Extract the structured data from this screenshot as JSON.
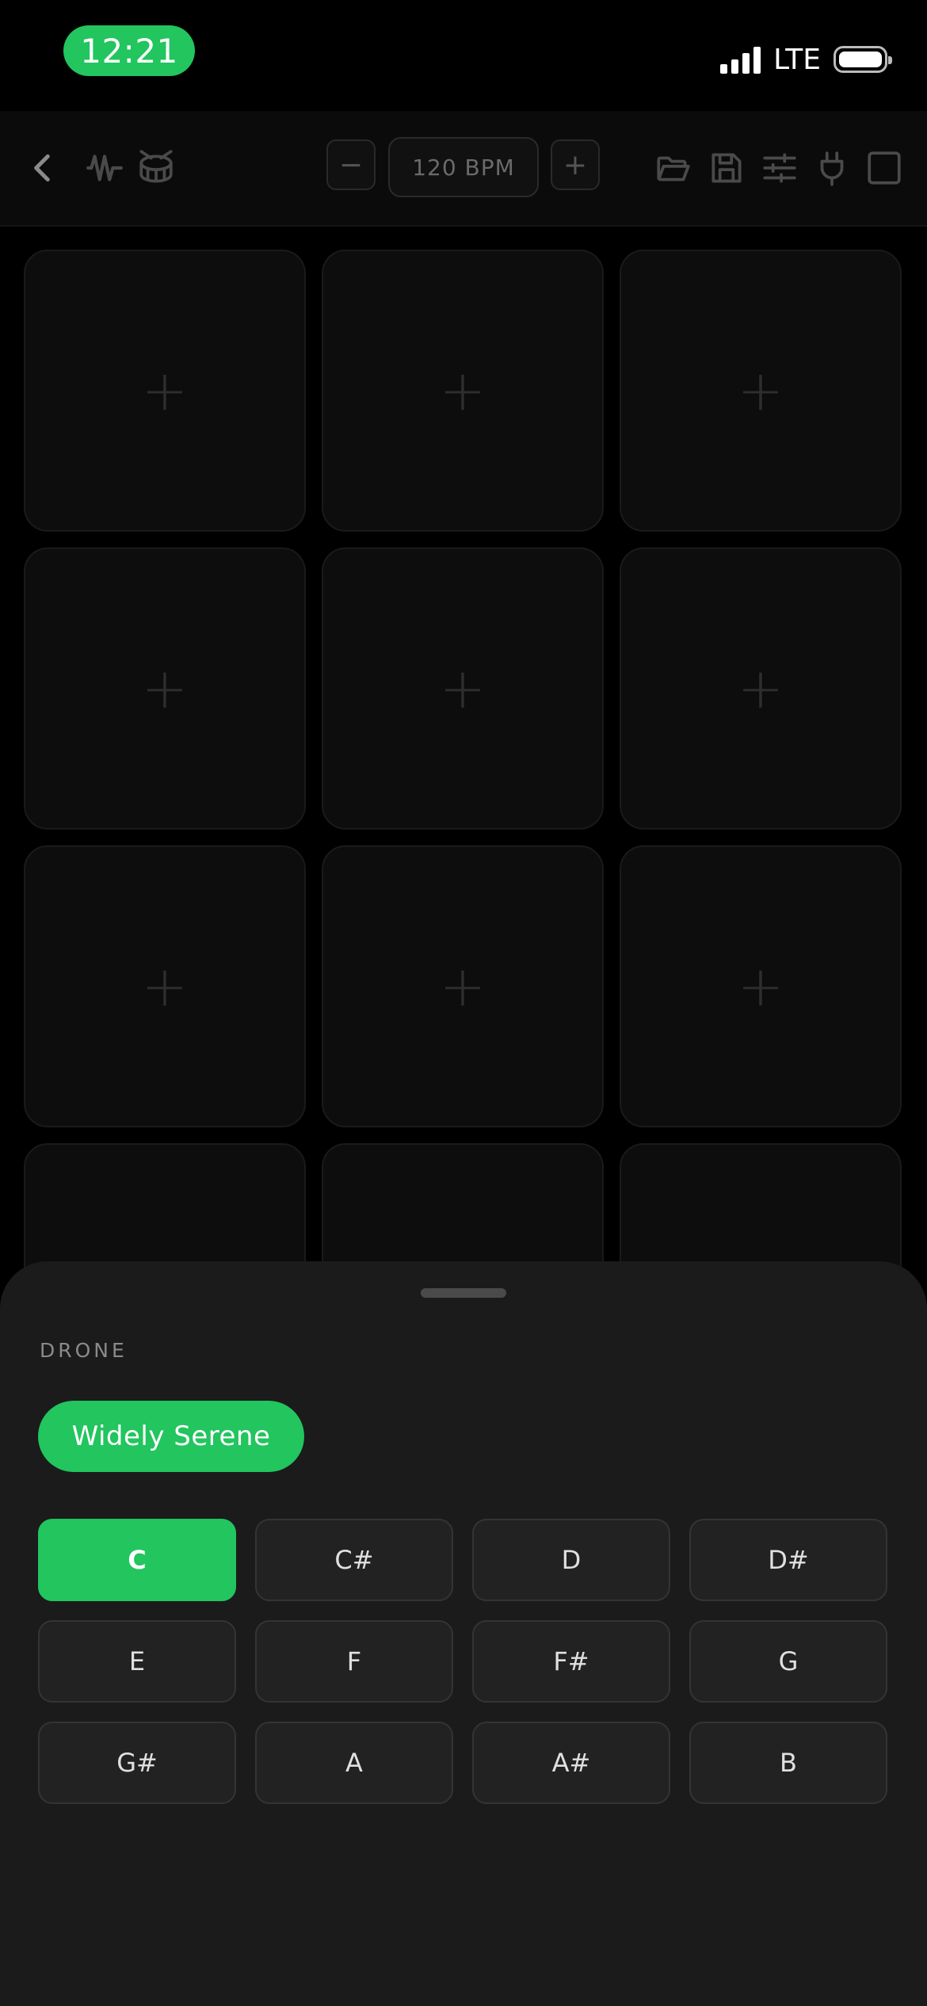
{
  "status_bar": {
    "time": "12:21",
    "network": "LTE"
  },
  "toolbar": {
    "back_icon": "chevron-left-icon",
    "waveform_icon": "waveform-icon",
    "drum_icon": "drum-icon",
    "bpm_decrement": "−",
    "bpm_value": "120 BPM",
    "bpm_increment": "+",
    "icons": [
      "folder-open-icon",
      "save-icon",
      "sliders-icon",
      "plug-icon",
      "stop-icon"
    ]
  },
  "pads": {
    "add_label": "+"
  },
  "sheet": {
    "section_label": "DRONE",
    "preset": "Widely Serene",
    "selected_key": "C",
    "keys": [
      "C",
      "C#",
      "D",
      "D#",
      "E",
      "F",
      "F#",
      "G",
      "G#",
      "A",
      "A#",
      "B"
    ]
  },
  "colors": {
    "accent": "#22c55e",
    "sheet_bg": "#1b1b1b",
    "app_bg": "#000000"
  }
}
